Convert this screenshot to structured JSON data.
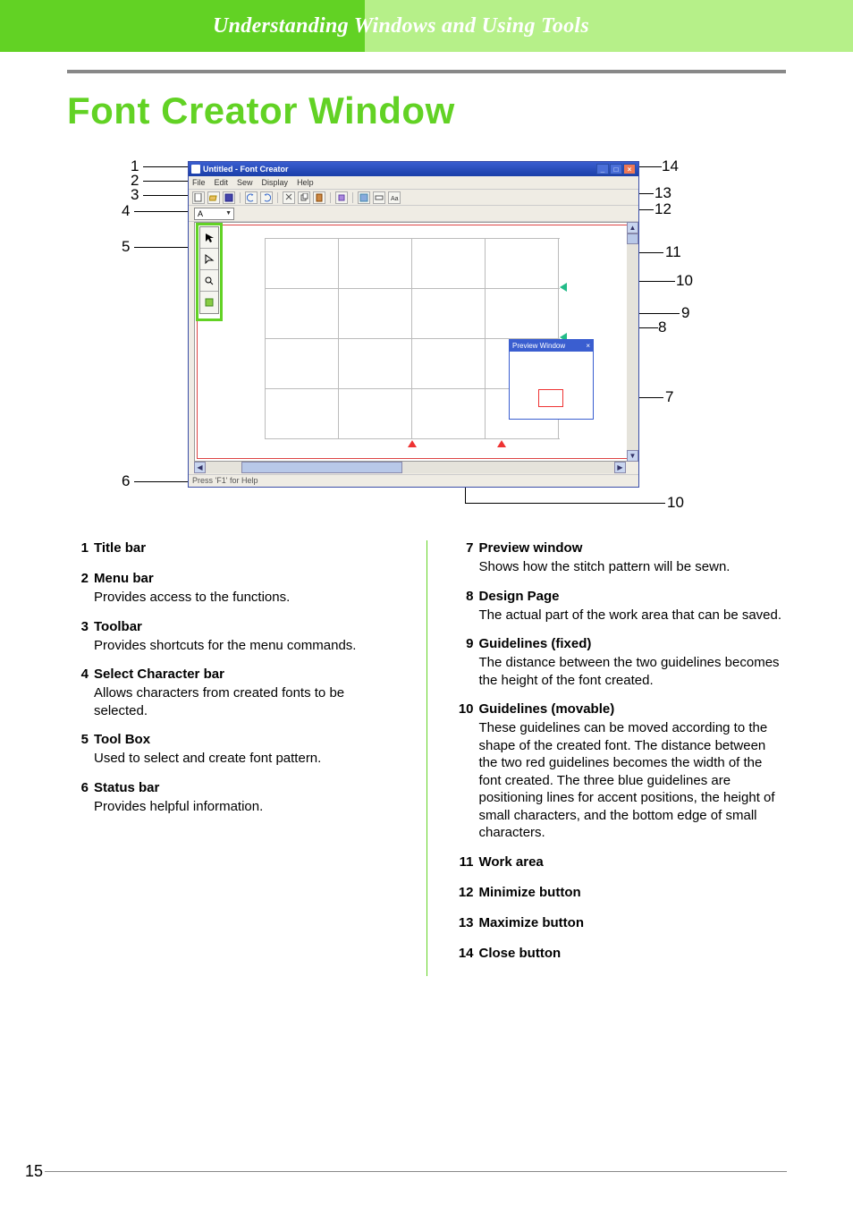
{
  "header": {
    "title": "Understanding Windows and Using Tools"
  },
  "pageTitle": "Font Creator Window",
  "pageNumber": "15",
  "app": {
    "titlebar": "Untitled - Font Creator",
    "menus": [
      "File",
      "Edit",
      "Sew",
      "Display",
      "Help"
    ],
    "charSelected": "A",
    "statusbar": "Press 'F1' for Help",
    "previewTitle": "Preview Window"
  },
  "callouts": {
    "left": [
      "1",
      "2",
      "3",
      "4",
      "5",
      "6"
    ],
    "right": [
      "14",
      "13",
      "12",
      "11",
      "10",
      "9",
      "8",
      "7",
      "10"
    ]
  },
  "legendLeft": [
    {
      "num": "1",
      "title": "Title bar",
      "desc": ""
    },
    {
      "num": "2",
      "title": "Menu bar",
      "desc": "Provides access to the functions."
    },
    {
      "num": "3",
      "title": "Toolbar",
      "desc": "Provides shortcuts for the menu commands."
    },
    {
      "num": "4",
      "title": "Select Character bar",
      "desc": "Allows characters from created fonts to be selected."
    },
    {
      "num": "5",
      "title": "Tool Box",
      "desc": "Used to select and create font pattern."
    },
    {
      "num": "6",
      "title": "Status bar",
      "desc": "Provides helpful information."
    }
  ],
  "legendRight": [
    {
      "num": "7",
      "title": "Preview window",
      "desc": "Shows how the stitch pattern will be sewn."
    },
    {
      "num": "8",
      "title": "Design Page",
      "desc": "The actual part of the work area that can be saved."
    },
    {
      "num": "9",
      "title": "Guidelines (fixed)",
      "desc": "The distance between the two guidelines becomes the height of the font created."
    },
    {
      "num": "10",
      "title": "Guidelines (movable)",
      "desc": "These guidelines can be moved according to the shape of the created font. The distance between the two red guidelines becomes the width of the font created. The three blue guidelines are positioning lines for accent positions, the height of small characters, and the bottom edge of small characters."
    },
    {
      "num": "11",
      "title": "Work area",
      "desc": ""
    },
    {
      "num": "12",
      "title": "Minimize button",
      "desc": ""
    },
    {
      "num": "13",
      "title": "Maximize button",
      "desc": ""
    },
    {
      "num": "14",
      "title": "Close button",
      "desc": ""
    }
  ]
}
